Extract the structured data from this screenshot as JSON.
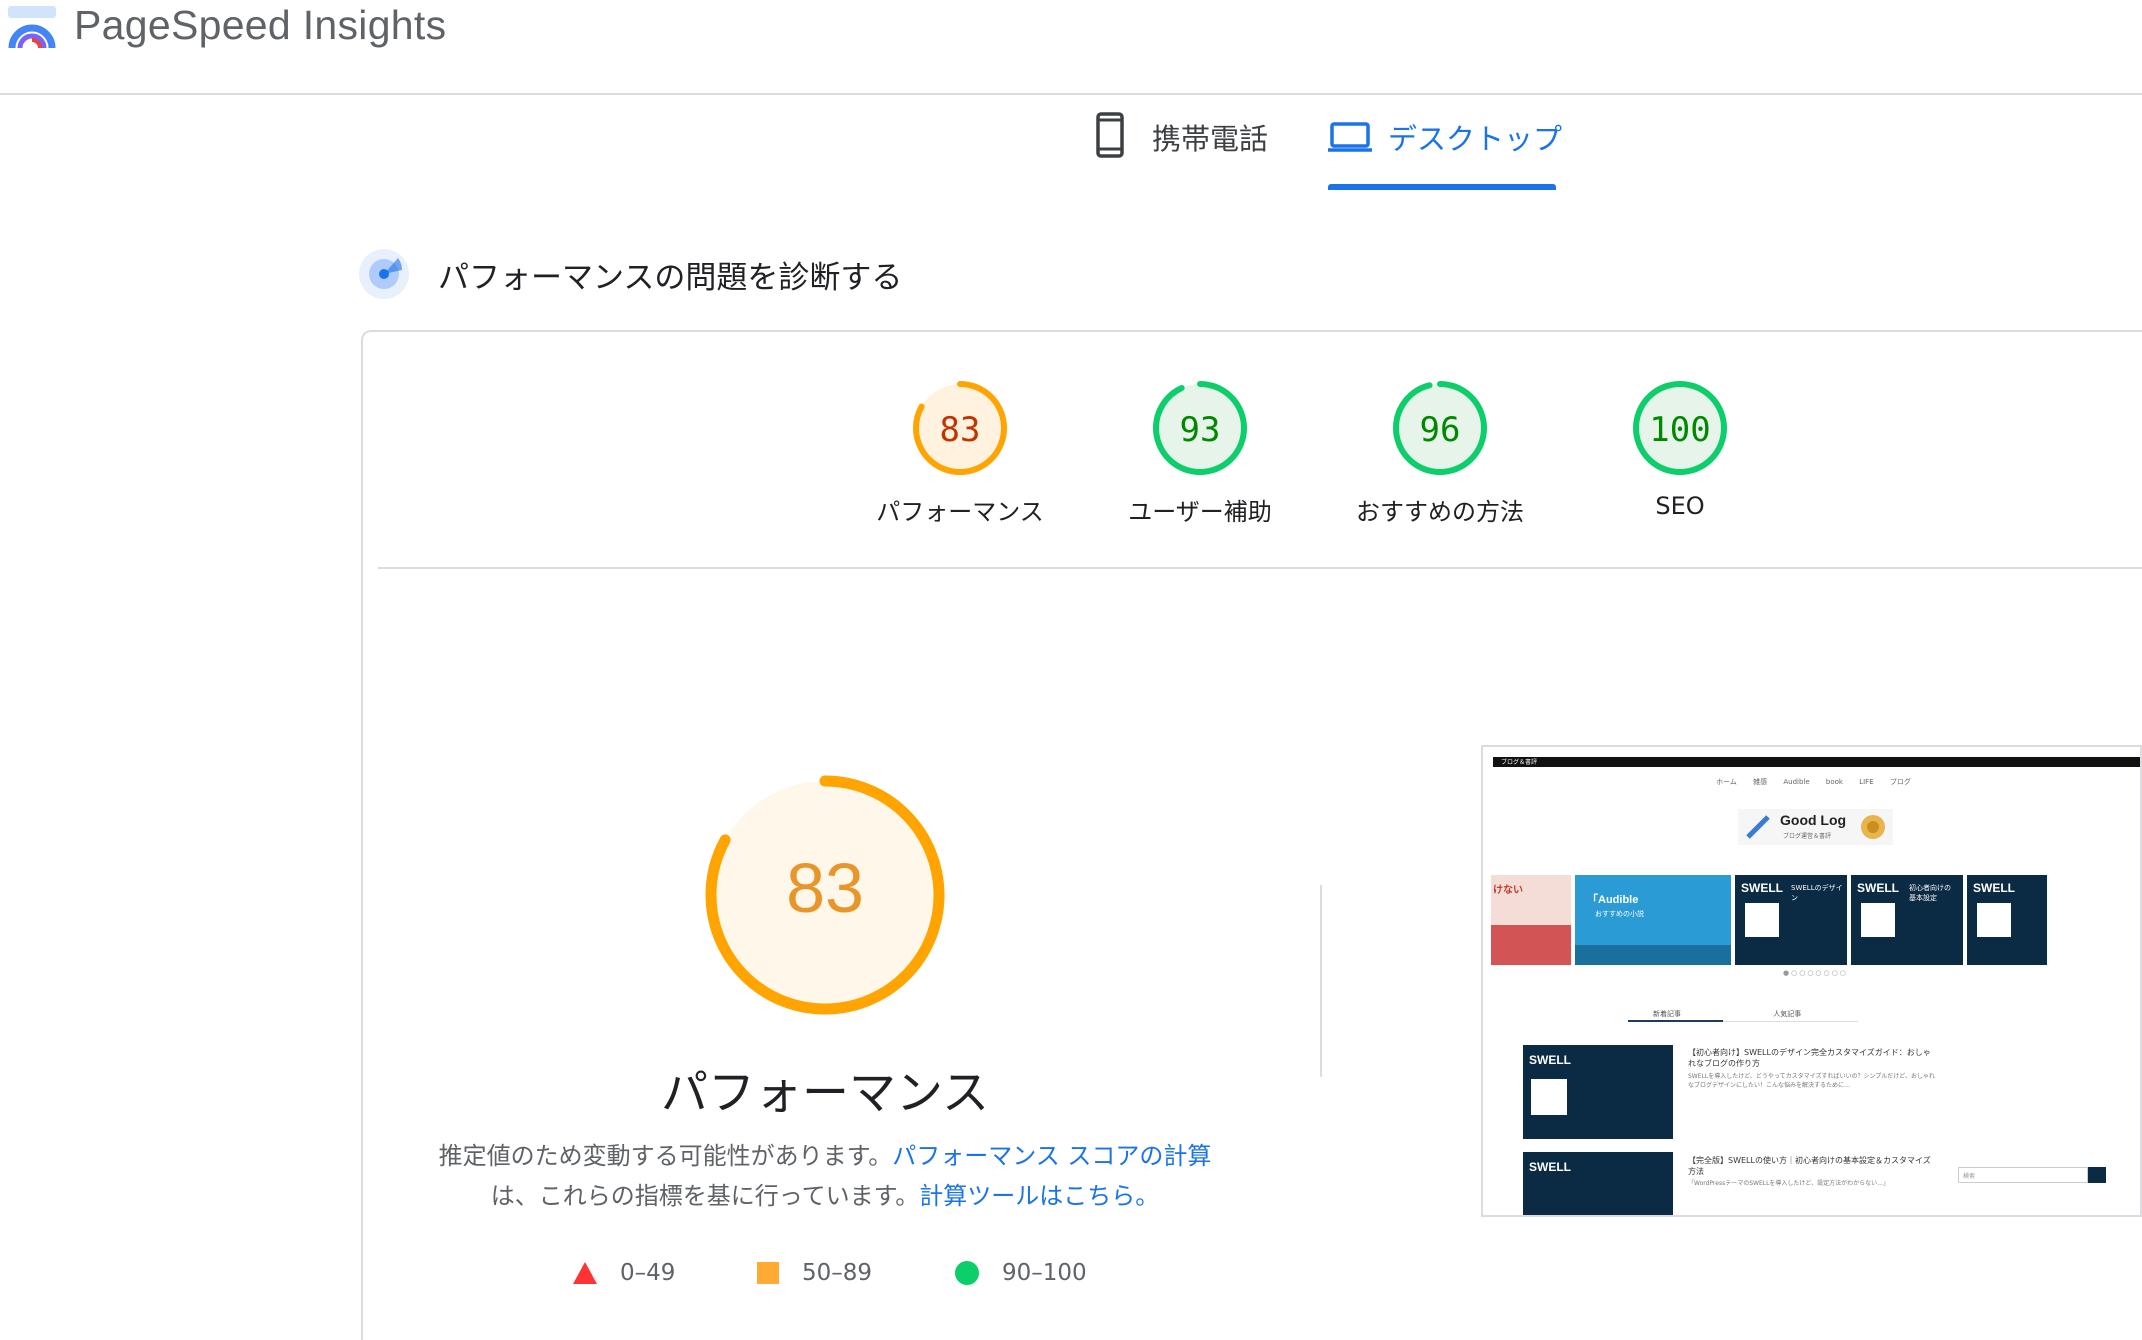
{
  "app": {
    "title": "PageSpeed Insights",
    "logo_icon": "pagespeed-gauge-icon"
  },
  "tabs": [
    {
      "label": "携帯電話",
      "icon": "mobile-phone-icon",
      "active": false
    },
    {
      "label": "デスクトップ",
      "icon": "laptop-icon",
      "active": true
    }
  ],
  "section": {
    "title": "パフォーマンスの問題を診断する",
    "icon": "lighthouse-icon"
  },
  "scores": [
    {
      "value": "83",
      "label": "パフォーマンス",
      "score": 83,
      "color": "#c33300",
      "ring": "#ffa400",
      "fill": "#fff3e0"
    },
    {
      "value": "93",
      "label": "ユーザー補助",
      "score": 93,
      "color": "#008800",
      "ring": "#0cce6b",
      "fill": "#e6f4ea"
    },
    {
      "value": "96",
      "label": "おすすめの方法",
      "score": 96,
      "color": "#008800",
      "ring": "#0cce6b",
      "fill": "#e6f4ea"
    },
    {
      "value": "100",
      "label": "SEO",
      "score": 100,
      "color": "#008800",
      "ring": "#0cce6b",
      "fill": "#e6f4ea"
    }
  ],
  "main_score": {
    "value": "83",
    "score": 83,
    "title": "パフォーマンス",
    "desc_prefix": "推定値のため変動する可能性があります。",
    "link1": "パフォーマンス スコアの計算",
    "desc_mid": "は、これらの指標を基に行っています。",
    "link2": "計算ツールはこちら。"
  },
  "legend": [
    {
      "range": "0–49",
      "shape": "triangle",
      "color": "#ff3333"
    },
    {
      "range": "50–89",
      "shape": "square",
      "color": "#ffaa33"
    },
    {
      "range": "90–100",
      "shape": "circle",
      "color": "#0cce6b"
    }
  ],
  "thumbnail": {
    "site_tag": "ブログ＆書評",
    "nav": "ホーム 雑感 Audible book LIFE ブログ",
    "logo_title": "Good Log",
    "logo_sub": "ブログ運営＆書評",
    "slide1": "けない",
    "slide2": "「Audible",
    "slide2_sub": "おすすめの小説",
    "slide3": "SWELL",
    "slide3_sub": "SWELLのデザイン",
    "slide4": "SWELL",
    "slide4_sub": "初心者向けの 基本設定",
    "slide5": "SWELL",
    "dots": "●○○○○○○○",
    "tab1": "新着記事",
    "tab2": "人気記事",
    "post1_img": "SWELL",
    "post1_title": "【初心者向け】SWELLのデザイン完全カスタマイズガイド：おしゃれなブログの作り方",
    "post1_body": "SWELLを導入したけど、どうやってカスタマイズすればいいの？シンプルだけど、おしゃれなブログデザインにしたい！こんな悩みを解決するために…",
    "post2_img": "SWELL",
    "post2_title": "【完全版】SWELLの使い方｜初心者向けの基本設定＆カスタマイズ方法",
    "post2_body": "「WordPressテーマのSWELLを導入したけど、設定方法がわからない…」",
    "search_placeholder": "検索"
  }
}
